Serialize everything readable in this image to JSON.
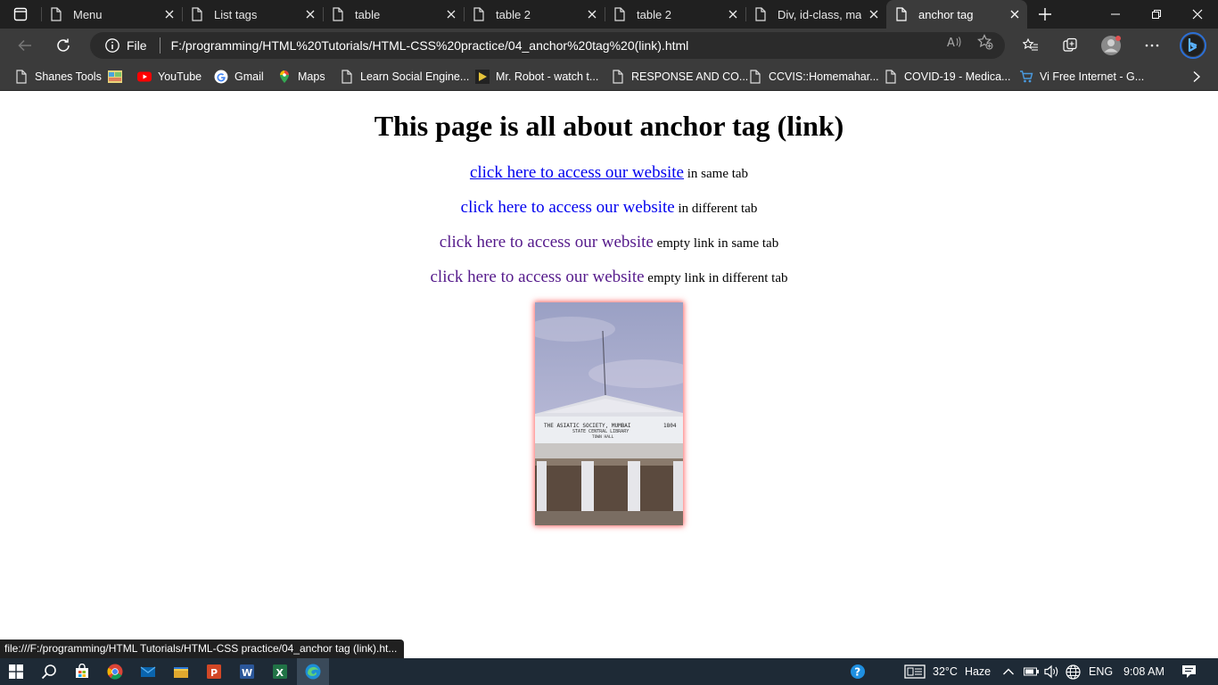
{
  "browser": {
    "tabs": [
      {
        "title": "Menu",
        "active": false
      },
      {
        "title": "List tags",
        "active": false
      },
      {
        "title": "table",
        "active": false
      },
      {
        "title": "table 2",
        "active": false
      },
      {
        "title": "table 2",
        "active": false
      },
      {
        "title": "Div, id-class, marq",
        "active": false
      },
      {
        "title": "anchor tag",
        "active": true
      }
    ],
    "address": {
      "scheme_label": "File",
      "url": "F:/programming/HTML%20Tutorials/HTML-CSS%20practice/04_anchor%20tag%20(link).html"
    },
    "bookmarks": [
      {
        "label": "Shanes Tools",
        "icon": "document-icon"
      },
      {
        "label": "",
        "icon": "colorful-favicon-icon"
      },
      {
        "label": "YouTube",
        "icon": "youtube-icon"
      },
      {
        "label": "Gmail",
        "icon": "google-icon"
      },
      {
        "label": "Maps",
        "icon": "maps-pin-icon"
      },
      {
        "label": "Learn Social Engine...",
        "icon": "document-icon"
      },
      {
        "label": "Mr. Robot - watch t...",
        "icon": "play-icon"
      },
      {
        "label": "RESPONSE AND CO...",
        "icon": "document-icon"
      },
      {
        "label": "CCVIS::Homemahar...",
        "icon": "document-icon"
      },
      {
        "label": "COVID-19 - Medica...",
        "icon": "document-icon"
      },
      {
        "label": "Vi Free Internet - G...",
        "icon": "cart-icon"
      }
    ]
  },
  "page": {
    "heading": "This page is all about anchor tag (link)",
    "links": [
      {
        "link_text": "click here to access our website",
        "suffix": "in same tab",
        "style": "underlined-blue"
      },
      {
        "link_text": "click here to access our website",
        "suffix": "in different tab",
        "style": "blue"
      },
      {
        "link_text": "click here to access our website",
        "suffix": "empty link in same tab",
        "style": "visited-purple"
      },
      {
        "link_text": "click here to access our website",
        "suffix": "empty link in different tab",
        "style": "visited-purple"
      }
    ],
    "image": {
      "sign_line1": "THE ASIATIC SOCIETY, MUMBAI",
      "sign_year": "1804",
      "sign_line2": "STATE CENTRAL LIBRARY",
      "sign_line3": "TOWN    HALL"
    }
  },
  "status_bar": {
    "url": "file:///F:/programming/HTML Tutorials/HTML-CSS practice/04_anchor tag (link).ht..."
  },
  "taskbar": {
    "apps": [
      "start-icon",
      "search-icon",
      "store-icon",
      "chrome-icon",
      "mail-icon",
      "file-explorer-icon",
      "powerpoint-icon",
      "word-icon",
      "excel-icon",
      "edge-icon"
    ],
    "weather": {
      "temp": "32°C",
      "condition": "Haze"
    },
    "language": "ENG",
    "time": "9:08 AM"
  },
  "colors": {
    "tab_strip": "#202020",
    "toolbar": "#3b3b3b",
    "link_blue": "#0000ee",
    "link_visited": "#551a8b",
    "image_glow": "#ff4646"
  }
}
